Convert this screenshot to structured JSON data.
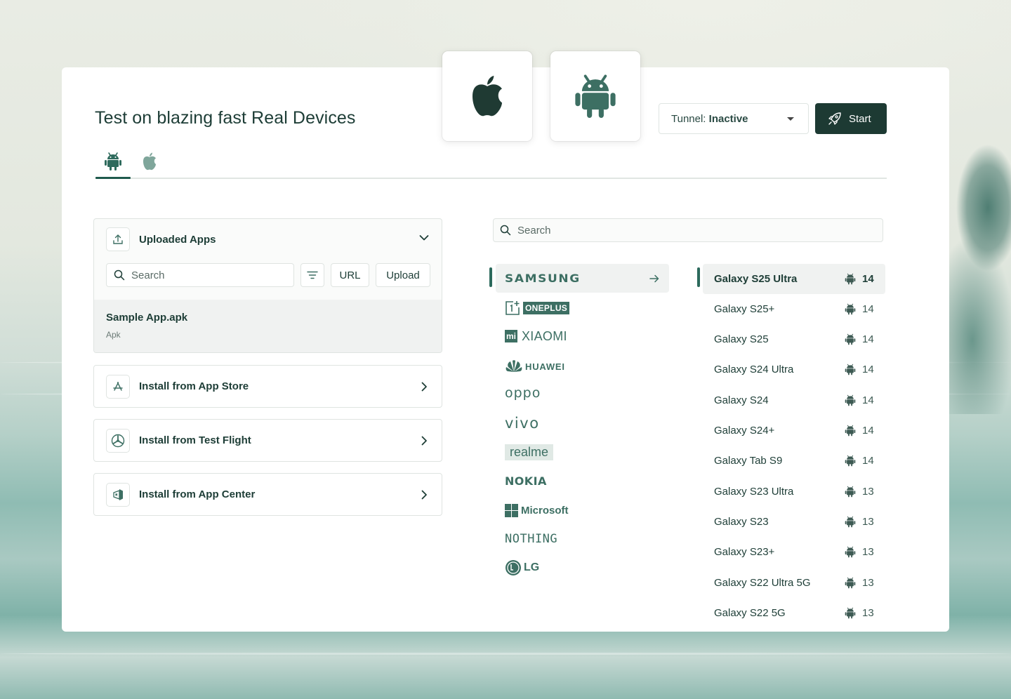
{
  "colors": {
    "accent": "#1d3a33",
    "brand_green": "#3d6f63",
    "border": "#dfe4e1"
  },
  "header": {
    "title": "Test on blazing fast Real Devices",
    "os_tiles": [
      {
        "icon": "apple-icon"
      },
      {
        "icon": "android-icon"
      }
    ],
    "tunnel_label": "Tunnel:",
    "tunnel_value": "Inactive",
    "start_label": "Start"
  },
  "tabs": [
    {
      "icon": "android-icon",
      "active": true
    },
    {
      "icon": "apple-icon",
      "active": false
    }
  ],
  "uploaded_apps": {
    "title": "Uploaded Apps",
    "search_placeholder": "Search",
    "url_label": "URL",
    "upload_label": "Upload",
    "items": [
      {
        "name": "Sample App.apk",
        "type": "Apk"
      }
    ]
  },
  "install_options": [
    {
      "label": "Install from App Store",
      "icon": "app-store-icon"
    },
    {
      "label": "Install from Test Flight",
      "icon": "test-flight-icon"
    },
    {
      "label": "Install from App Center",
      "icon": "app-center-icon"
    }
  ],
  "device_search_placeholder": "Search",
  "brands": [
    "SAMSUNG",
    "ONEPLUS",
    "XIAOMI",
    "HUAWEI",
    "oppo",
    "vivo",
    "realme",
    "NOKIA",
    "Microsoft",
    "NOTHING",
    "LG"
  ],
  "selected_brand": "SAMSUNG",
  "devices": [
    {
      "name": "Galaxy S25 Ultra",
      "version": "14"
    },
    {
      "name": "Galaxy S25+",
      "version": "14"
    },
    {
      "name": "Galaxy S25",
      "version": "14"
    },
    {
      "name": "Galaxy S24 Ultra",
      "version": "14"
    },
    {
      "name": "Galaxy S24",
      "version": "14"
    },
    {
      "name": "Galaxy S24+",
      "version": "14"
    },
    {
      "name": "Galaxy Tab S9",
      "version": "14"
    },
    {
      "name": "Galaxy S23 Ultra",
      "version": "13"
    },
    {
      "name": "Galaxy S23",
      "version": "13"
    },
    {
      "name": "Galaxy S23+",
      "version": "13"
    },
    {
      "name": "Galaxy S22 Ultra 5G",
      "version": "13"
    },
    {
      "name": "Galaxy S22 5G",
      "version": "13"
    }
  ]
}
